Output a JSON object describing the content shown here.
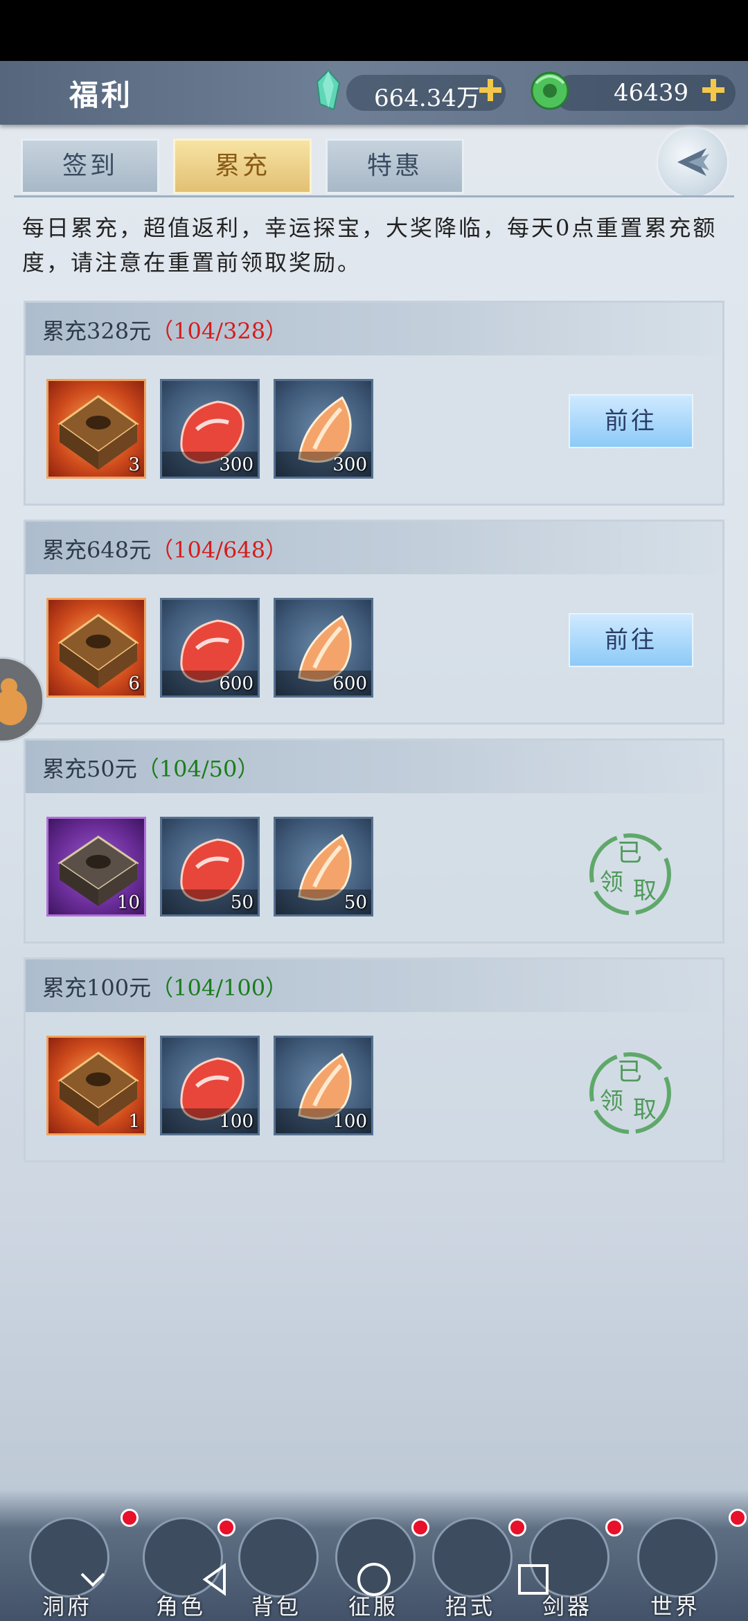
{
  "header": {
    "title": "福利",
    "currency1": {
      "value": "664.34万",
      "icon": "spirit-crystal-icon"
    },
    "currency2": {
      "value": "46439",
      "icon": "jade-coin-icon"
    },
    "plus_label": "+"
  },
  "tabs": [
    {
      "label": "签到",
      "active": false
    },
    {
      "label": "累充",
      "active": true
    },
    {
      "label": "特惠",
      "active": false
    }
  ],
  "description": "每日累充，超值返利，幸运探宝，大奖降临，每天0点重置累充额度，请注意在重置前领取奖励。",
  "tiers": [
    {
      "title": "累充328元",
      "open": "（",
      "progress": "104/328",
      "close": "）",
      "progress_color": "red",
      "items": [
        {
          "kind": "orange-chest",
          "count": "3"
        },
        {
          "kind": "red-stone",
          "count": "300"
        },
        {
          "kind": "gold-stone",
          "count": "300"
        }
      ],
      "action": "前往",
      "claimed": false
    },
    {
      "title": "累充648元",
      "open": "（",
      "progress": "104/648",
      "close": "）",
      "progress_color": "red",
      "items": [
        {
          "kind": "orange-chest",
          "count": "6"
        },
        {
          "kind": "red-stone",
          "count": "600"
        },
        {
          "kind": "gold-stone",
          "count": "600"
        }
      ],
      "action": "前往",
      "claimed": false
    },
    {
      "title": "累充50元",
      "open": "（",
      "progress": "104/50",
      "close": "）",
      "progress_color": "green",
      "items": [
        {
          "kind": "purple-chest",
          "count": "10"
        },
        {
          "kind": "red-stone",
          "count": "50"
        },
        {
          "kind": "gold-stone",
          "count": "50"
        }
      ],
      "stamp": {
        "line1": "已",
        "line2": "领",
        "line3": "取"
      },
      "claimed": true
    },
    {
      "title": "累充100元",
      "open": "（",
      "progress": "104/100",
      "close": "）",
      "progress_color": "green",
      "items": [
        {
          "kind": "orange-chest",
          "count": "1"
        },
        {
          "kind": "red-stone",
          "count": "100"
        },
        {
          "kind": "gold-stone",
          "count": "100"
        }
      ],
      "stamp": {
        "line1": "已",
        "line2": "领",
        "line3": "取"
      },
      "claimed": true
    }
  ],
  "bottom_nav": [
    {
      "label": "洞府",
      "icon": "cave-house-icon",
      "badge": true
    },
    {
      "label": "角色",
      "icon": "swordsman-icon",
      "badge": true
    },
    {
      "label": "背包",
      "icon": "bag-icon",
      "badge": false
    },
    {
      "label": "征服",
      "icon": "crossed-swords-icon",
      "badge": true
    },
    {
      "label": "招式",
      "icon": "skill-book-icon",
      "badge": true
    },
    {
      "label": "剑器",
      "icon": "sword-icon",
      "badge": true
    },
    {
      "label": "世界",
      "icon": "world-scroll-icon",
      "badge": true
    }
  ],
  "system_nav": [
    "chevron-down-icon",
    "back-triangle-icon",
    "home-circle-icon",
    "recent-square-icon"
  ],
  "colors": {
    "red": "#d41d1d",
    "green": "#1a7d1a",
    "gold_tab": "#e2c073",
    "go_button": "#8ccaf7"
  }
}
